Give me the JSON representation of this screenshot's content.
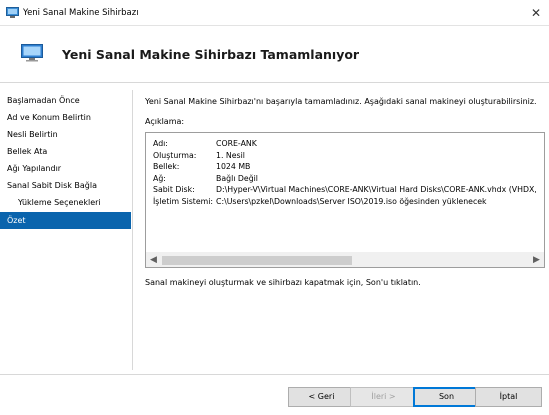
{
  "window": {
    "title": "Yeni Sanal Makine Sihirbazı"
  },
  "header": {
    "title": "Yeni Sanal Makine Sihirbazı Tamamlanıyor"
  },
  "nav": {
    "items": [
      {
        "label": "Başlamadan Önce"
      },
      {
        "label": "Ad ve Konum Belirtin"
      },
      {
        "label": "Nesli Belirtin"
      },
      {
        "label": "Bellek Ata"
      },
      {
        "label": "Ağı Yapılandır"
      },
      {
        "label": "Sanal Sabit Disk Bağla"
      },
      {
        "label": "Yükleme Seçenekleri"
      },
      {
        "label": "Özet"
      }
    ]
  },
  "content": {
    "intro": "Yeni Sanal Makine Sihirbazı'nı başarıyla tamamladınız. Aşağıdaki sanal makineyi oluşturabilirsiniz.",
    "description_label": "Açıklama:",
    "summary": [
      {
        "key": "Adı:",
        "value": "CORE-ANK"
      },
      {
        "key": "Oluşturma:",
        "value": "1. Nesil"
      },
      {
        "key": "Bellek:",
        "value": "1024 MB"
      },
      {
        "key": "Ağ:",
        "value": "Bağlı Değil"
      },
      {
        "key": "Sabit Disk:",
        "value": "D:\\Hyper-V\\Virtual Machines\\CORE-ANK\\Virtual Hard Disks\\CORE-ANK.vhdx (VHDX, d"
      },
      {
        "key": "İşletim Sistemi:",
        "value": "C:\\Users\\pzkel\\Downloads\\Server ISO\\2019.iso öğesinden yüklenecek"
      }
    ],
    "footer_note": "Sanal makineyi oluşturmak ve sihirbazı kapatmak için, Son'u tıklatın."
  },
  "buttons": {
    "back": "< Geri",
    "next": "İleri >",
    "finish": "Son",
    "cancel": "İptal"
  },
  "colors": {
    "accent": "#0a64ad",
    "default_button_border": "#0078d7"
  }
}
